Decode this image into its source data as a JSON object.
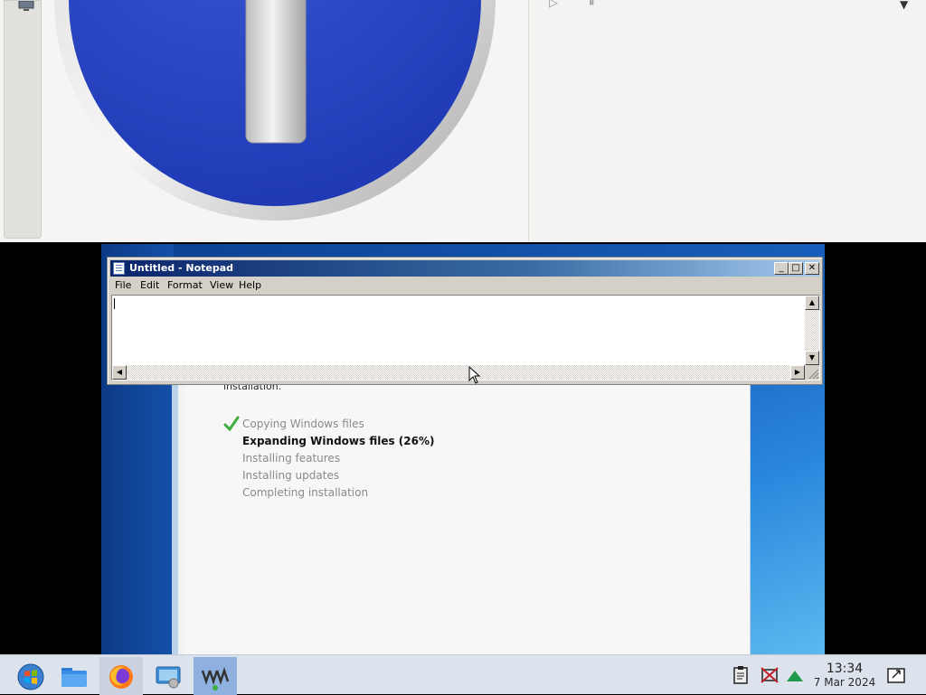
{
  "notepad": {
    "title": "Untitled - Notepad",
    "menu": [
      "File",
      "Edit",
      "Format",
      "View",
      "Help"
    ],
    "content": "",
    "minimize": "_",
    "maximize": "□",
    "close": "✕"
  },
  "setup": {
    "tail_text": "installation.",
    "steps": [
      {
        "label": "Copying Windows files",
        "state": "done"
      },
      {
        "label": "Expanding Windows files (26%)",
        "state": "active"
      },
      {
        "label": "Installing features",
        "state": "pending"
      },
      {
        "label": "Installing updates",
        "state": "pending"
      },
      {
        "label": "Completing installation",
        "state": "pending"
      }
    ],
    "progress_percent": 26
  },
  "taskbar": {
    "apps": [
      {
        "name": "start-menu",
        "icon": "windows-orb-icon"
      },
      {
        "name": "file-manager",
        "icon": "folder-icon"
      },
      {
        "name": "firefox",
        "icon": "firefox-icon"
      },
      {
        "name": "system-settings",
        "icon": "settings-icon"
      },
      {
        "name": "virt-manager",
        "icon": "virt-manager-icon"
      }
    ],
    "clock_time": "13:34",
    "clock_date": "7 Mar 2024",
    "tray": [
      "clipboard-icon",
      "network-disabled-icon",
      "updates-icon",
      "screenshot-icon"
    ]
  },
  "colors": {
    "accent_blue": "#2a49c1",
    "title_bar_start": "#0a246a",
    "check_green": "#3dae3d"
  }
}
